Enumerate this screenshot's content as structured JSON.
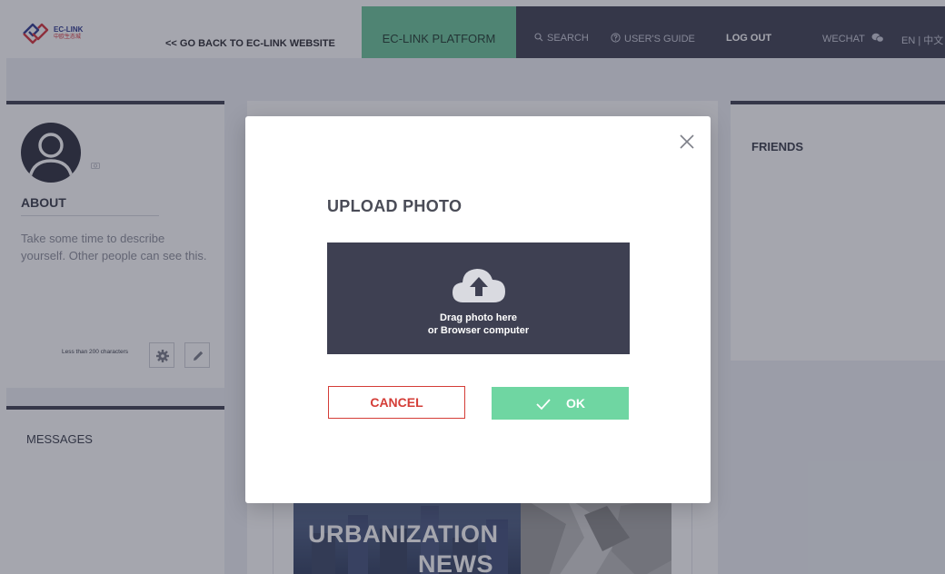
{
  "header": {
    "logo_text": "EC-LINK",
    "logo_sub": "中欧生态城",
    "back_link": "<< GO BACK TO EC-LINK WEBSITE",
    "platform_tab": "EC-LINK PLATFORM",
    "nav": {
      "search": "SEARCH",
      "guide": "USER'S GUIDE",
      "logout": "LOG OUT",
      "wechat": "WECHAT",
      "language": "EN | 中文"
    }
  },
  "about": {
    "title": "ABOUT",
    "text": "Take some time to describe yourself. Other people can see this.",
    "char_limit": "Less than 200 characters"
  },
  "messages": {
    "title": "MESSAGES"
  },
  "friends": {
    "title": "FRIENDS"
  },
  "news": {
    "title_line1": "URBANIZATION",
    "title_line2": "NEWS"
  },
  "modal": {
    "title": "UPLOAD PHOTO",
    "drop_line1": "Drag photo here",
    "drop_line2": "or Browser computer",
    "cancel_label": "CANCEL",
    "ok_label": "OK"
  },
  "icons": {
    "close": "close-icon",
    "cloud": "cloud-upload-icon",
    "check": "check-icon",
    "search": "search-icon",
    "help": "help-icon",
    "wechat": "wechat-icon",
    "settings": "gear-icon",
    "edit": "pencil-icon",
    "camera": "camera-icon",
    "avatar": "user-avatar-icon"
  },
  "colors": {
    "nav_dark": "#3e4052",
    "platform_green": "#6cc49a",
    "ok_green": "#6fd6a2",
    "cancel_red": "#d43d37"
  }
}
